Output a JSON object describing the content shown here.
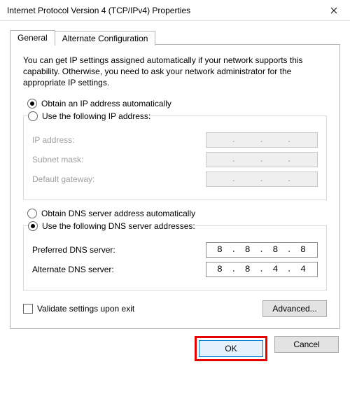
{
  "window": {
    "title": "Internet Protocol Version 4 (TCP/IPv4) Properties"
  },
  "tabs": {
    "general": "General",
    "alternate": "Alternate Configuration"
  },
  "description": "You can get IP settings assigned automatically if your network supports this capability. Otherwise, you need to ask your network administrator for the appropriate IP settings.",
  "ip": {
    "auto_label": "Obtain an IP address automatically",
    "manual_label": "Use the following IP address:",
    "fields": {
      "address": "IP address:",
      "subnet": "Subnet mask:",
      "gateway": "Default gateway:"
    },
    "values": {
      "address": [
        "",
        "",
        "",
        ""
      ],
      "subnet": [
        "",
        "",
        "",
        ""
      ],
      "gateway": [
        "",
        "",
        "",
        ""
      ]
    },
    "selected": "auto"
  },
  "dns": {
    "auto_label": "Obtain DNS server address automatically",
    "manual_label": "Use the following DNS server addresses:",
    "fields": {
      "preferred": "Preferred DNS server:",
      "alternate": "Alternate DNS server:"
    },
    "values": {
      "preferred": [
        "8",
        "8",
        "8",
        "8"
      ],
      "alternate": [
        "8",
        "8",
        "4",
        "4"
      ]
    },
    "selected": "manual"
  },
  "validate_label": "Validate settings upon exit",
  "validate_checked": false,
  "buttons": {
    "advanced": "Advanced...",
    "ok": "OK",
    "cancel": "Cancel"
  }
}
